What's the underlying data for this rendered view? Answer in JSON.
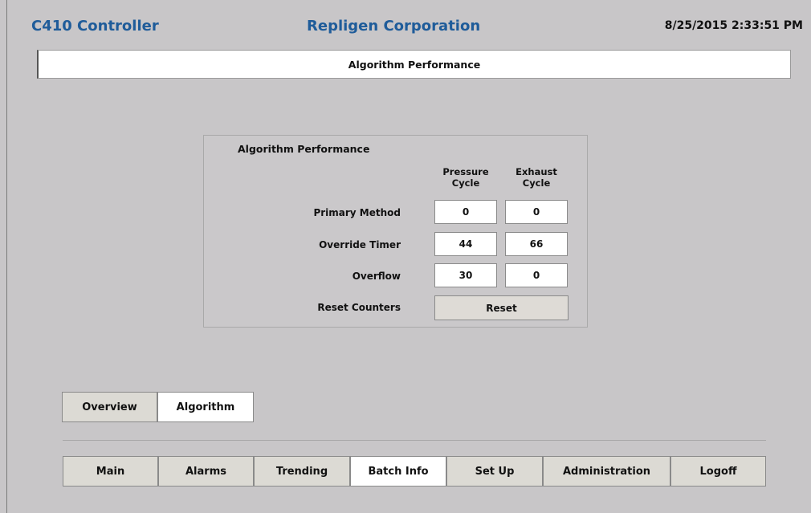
{
  "header": {
    "app_title": "C410 Controller",
    "company": "Repligen Corporation",
    "datetime": "8/25/2015 2:33:51 PM"
  },
  "page": {
    "title": "Algorithm Performance"
  },
  "panel": {
    "title": "Algorithm Performance",
    "columns": [
      {
        "line1": "Pressure",
        "line2": "Cycle"
      },
      {
        "line1": "Exhaust",
        "line2": "Cycle"
      }
    ],
    "rows": [
      {
        "label": "Primary Method",
        "pressure": "0",
        "exhaust": "0"
      },
      {
        "label": "Override Timer",
        "pressure": "44",
        "exhaust": "66"
      },
      {
        "label": "Overflow",
        "pressure": "30",
        "exhaust": "0"
      }
    ],
    "reset_label": "Reset Counters",
    "reset_button": "Reset"
  },
  "sub_tabs": [
    {
      "label": "Overview",
      "active": false
    },
    {
      "label": "Algorithm",
      "active": true
    }
  ],
  "nav": [
    {
      "label": "Main",
      "active": false
    },
    {
      "label": "Alarms",
      "active": false
    },
    {
      "label": "Trending",
      "active": false
    },
    {
      "label": "Batch Info",
      "active": true
    },
    {
      "label": "Set Up",
      "active": false
    },
    {
      "label": "Administration",
      "active": false
    },
    {
      "label": "Logoff",
      "active": false
    }
  ],
  "colors": {
    "background": "#c8c6c8",
    "title_blue": "#1f5c9a",
    "button_face": "#dcdad4",
    "active_tab": "#ffffff"
  }
}
